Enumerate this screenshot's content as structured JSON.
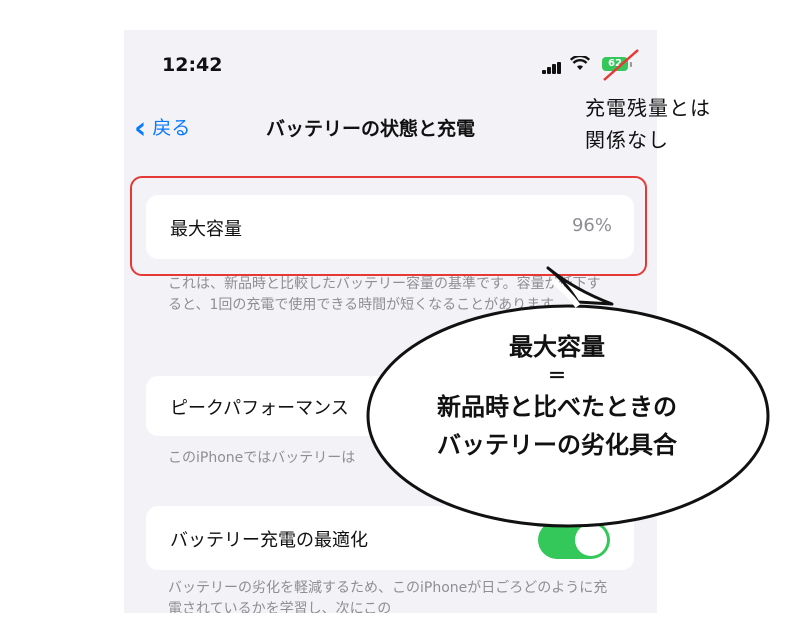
{
  "status_bar": {
    "time": "12:42",
    "battery_level": "62"
  },
  "nav": {
    "back_label": "戻る",
    "title": "バッテリーの状態と充電"
  },
  "max_capacity": {
    "label": "最大容量",
    "value": "96%"
  },
  "max_capacity_note": "これは、新品時と比較したバッテリー容量の基準です。容量が低下すると、1回の充電で使用できる時間が短くなることがあります。",
  "peak_performance": {
    "label": "ピークパフォーマンス"
  },
  "peak_note": "このiPhoneではバッテリーは",
  "optimized_charging": {
    "label": "バッテリー充電の最適化",
    "enabled": true
  },
  "optimized_note": "バッテリーの劣化を軽減するため、このiPhoneが日ごろどのように充電されているかを学習し、次にこの",
  "annotations": {
    "handnote_line1": "充電残量とは",
    "handnote_line2": "関係なし",
    "bubble_line1": "最大容量",
    "bubble_line2": "＝",
    "bubble_line3": "新品時と比べたときの",
    "bubble_line4": "バッテリーの劣化具合"
  },
  "colors": {
    "accent": "#0a7aff",
    "toggle_on": "#34c759",
    "highlight": "#e53935"
  }
}
